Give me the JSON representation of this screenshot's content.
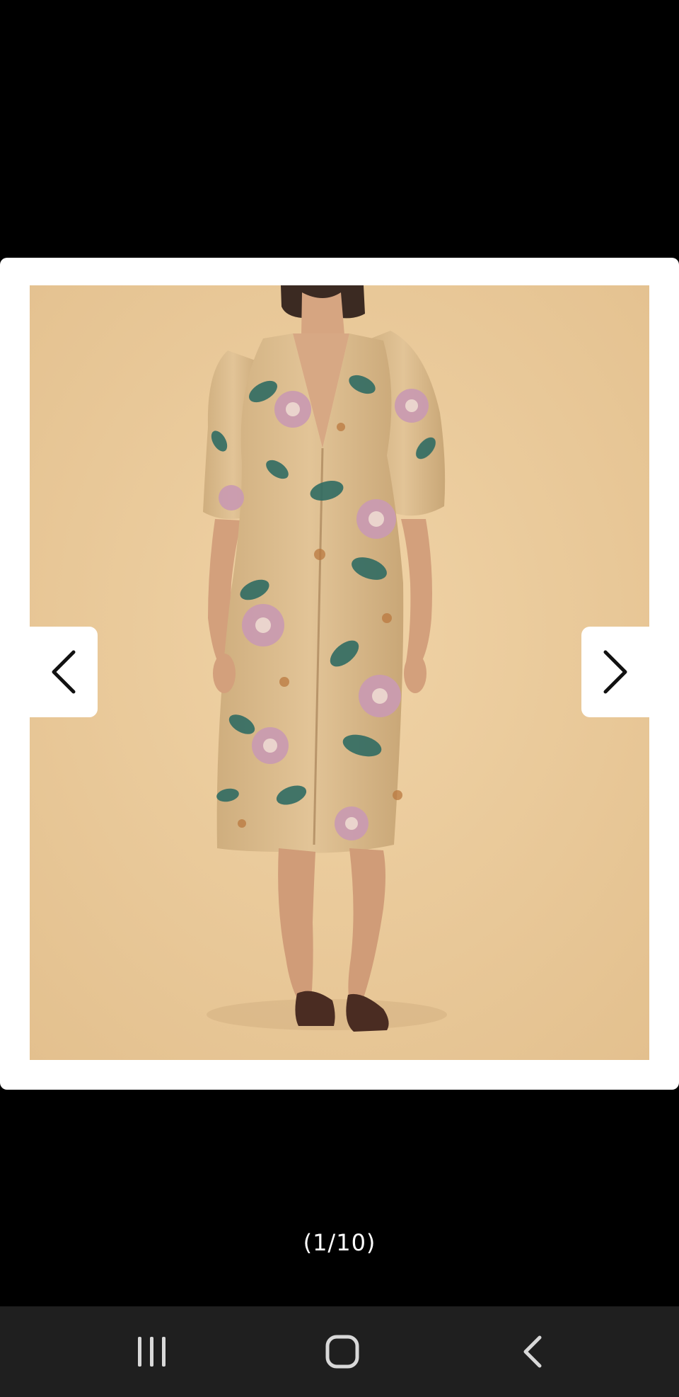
{
  "viewer": {
    "counter_text": "(1/10)",
    "prev_icon": "chevron-left-icon",
    "next_icon": "chevron-right-icon",
    "photo_subject": "model-wearing-floral-midi-dress",
    "colors": {
      "card_background": "#ffffff",
      "photo_background": "#e9c99a",
      "dress_base": "#d9b98a",
      "floral_green": "#2f6b63",
      "floral_pink": "#c99bb0",
      "shoes": "#4a2c22",
      "page_background": "#000000"
    }
  },
  "system_nav": {
    "recents_icon": "recents-icon",
    "home_icon": "home-icon",
    "back_icon": "back-icon",
    "background": "#1f1f1f"
  }
}
